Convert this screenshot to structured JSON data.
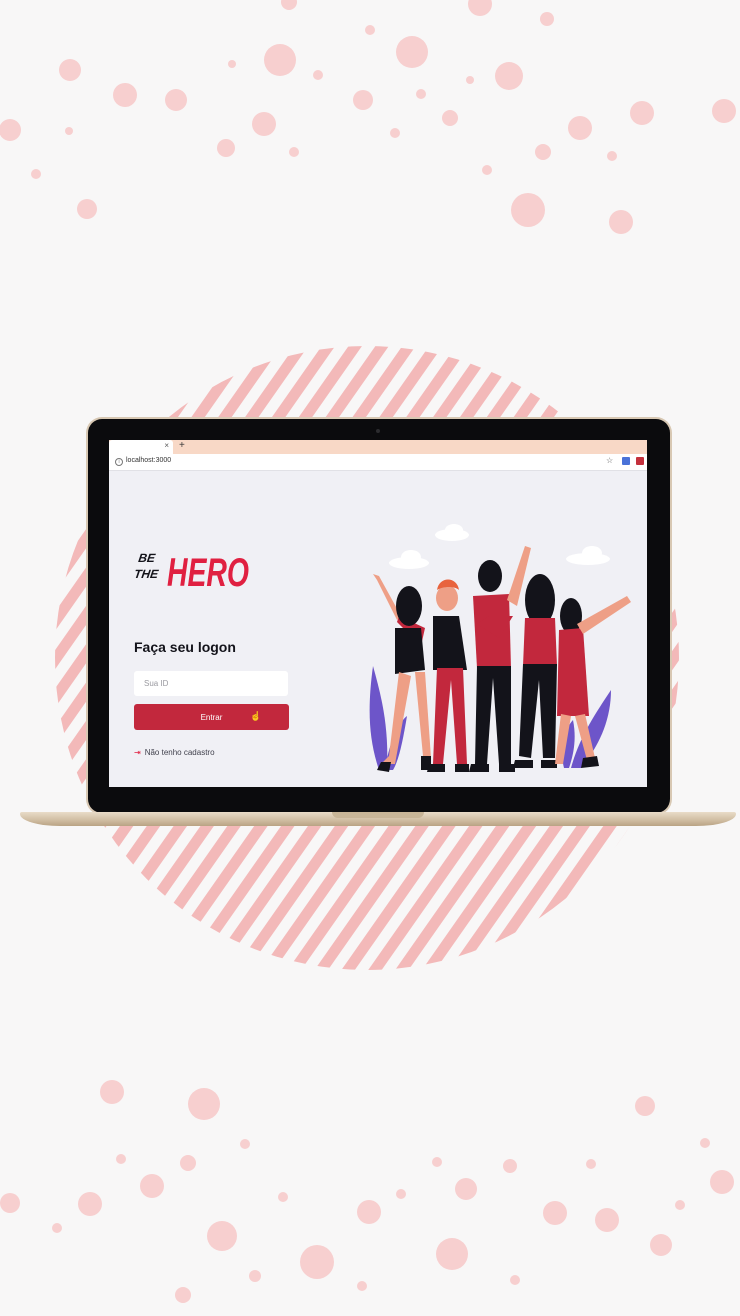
{
  "colors": {
    "brand_red": "#e02041",
    "button_red": "#c2283d",
    "page_background": "#f0f0f5",
    "decoration_pink": "#f3b9b9"
  },
  "browser": {
    "tab_close": "×",
    "new_tab": "+",
    "url": "localhost:3000",
    "icons": [
      "info-icon",
      "star-icon",
      "translate-icon",
      "extension-icon"
    ]
  },
  "logo": {
    "line1": "BE",
    "line2": "THE",
    "word": "HERO"
  },
  "login": {
    "title": "Faça seu logon",
    "id_placeholder": "Sua ID",
    "enter_label": "Entrar",
    "register_label": "Não tenho cadastro"
  }
}
